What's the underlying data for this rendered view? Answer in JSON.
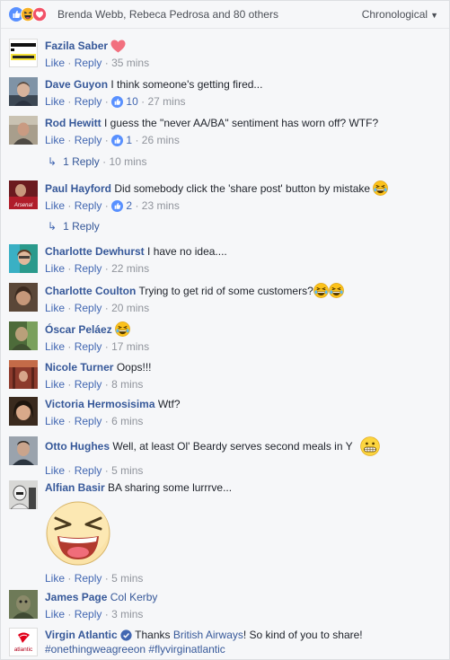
{
  "header": {
    "likers": "Brenda Webb, Rebeca Pedrosa and 80 others",
    "sort_label": "Chronological",
    "reaction_icons": [
      "like-icon",
      "haha-icon",
      "love-icon"
    ]
  },
  "comments": [
    {
      "name": "Fazila Saber",
      "text": "",
      "like": "Like",
      "reply": "Reply",
      "time": "35 mins",
      "likes": ""
    },
    {
      "name": "Dave Guyon",
      "text": "I think someone's getting fired...",
      "like": "Like",
      "reply": "Reply",
      "time": "27 mins",
      "likes": "10"
    },
    {
      "name": "Rod Hewitt",
      "text": "I guess the \"never AA/BA\" sentiment has worn off? WTF?",
      "like": "Like",
      "reply": "Reply",
      "time": "26 mins",
      "likes": "1",
      "replies": "1 Reply",
      "replies_time": "10 mins"
    },
    {
      "name": "Paul Hayford",
      "text": "Did somebody click the 'share post' button by mistake",
      "like": "Like",
      "reply": "Reply",
      "time": "23 mins",
      "likes": "2",
      "replies": "1 Reply"
    },
    {
      "name": "Charlotte Dewhurst",
      "text": "I have no idea....",
      "like": "Like",
      "reply": "Reply",
      "time": "22 mins"
    },
    {
      "name": "Charlotte Coulton",
      "text": "Trying to get rid of some customers?",
      "like": "Like",
      "reply": "Reply",
      "time": "20 mins"
    },
    {
      "name": "Óscar Peláez",
      "text": "",
      "like": "Like",
      "reply": "Reply",
      "time": "17 mins"
    },
    {
      "name": "Nicole Turner",
      "text": "Oops!!!",
      "like": "Like",
      "reply": "Reply",
      "time": "8 mins"
    },
    {
      "name": "Victoria Hermosisima",
      "text": "Wtf?",
      "like": "Like",
      "reply": "Reply",
      "time": "6 mins"
    },
    {
      "name": "Otto Hughes",
      "text": "Well, at least Ol' Beardy serves second meals in Y",
      "like": "Like",
      "reply": "Reply",
      "time": "5 mins"
    },
    {
      "name": "Alfian Basir",
      "text": "BA sharing some lurrrve...",
      "like": "Like",
      "reply": "Reply",
      "time": "5 mins"
    },
    {
      "name": "James Page",
      "text": "Col Kerby",
      "like": "Like",
      "reply": "Reply",
      "time": "3 mins"
    },
    {
      "name": "Virgin Atlantic",
      "text_pre": "Thanks ",
      "mention": "British Airways",
      "text_post": "! So kind of you to share!",
      "hashtags": "#onethingweagreeon #flyvirginatlantic"
    }
  ],
  "avatars": {
    "fazila": "elkammen\nA\nUNISEX",
    "paul": "Arsenal",
    "virgin": "atlantic"
  },
  "colors": {
    "link": "#365899",
    "action": "#4267b2",
    "meta": "#90949c",
    "like_blue": "#5890ff",
    "love_red": "#f25268",
    "virgin_red": "#e1001a"
  }
}
